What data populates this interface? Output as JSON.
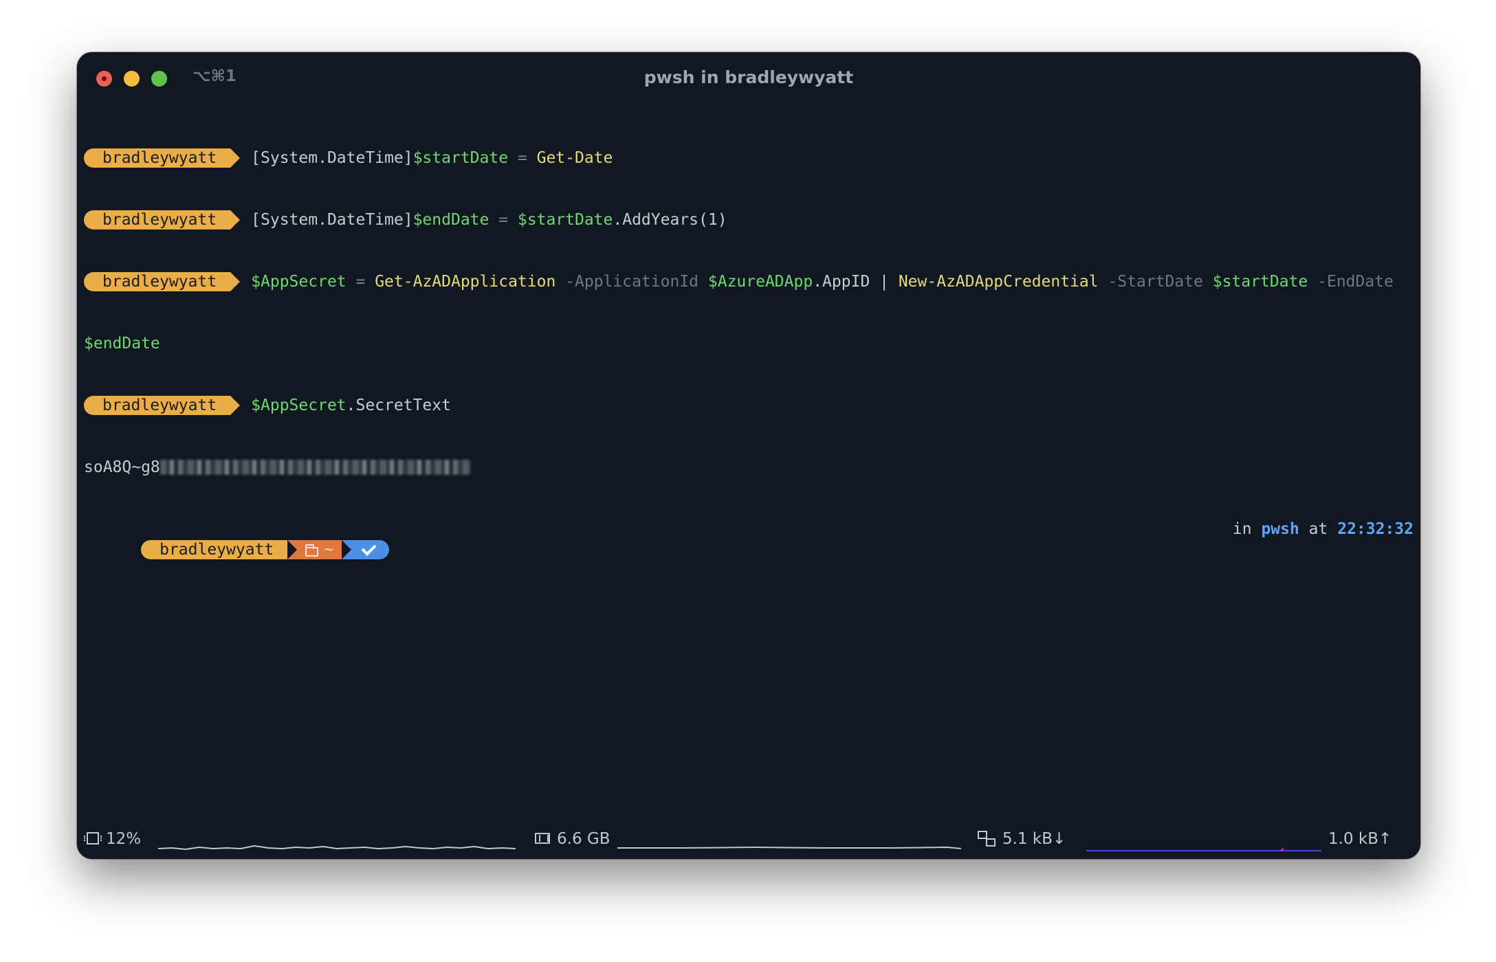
{
  "window": {
    "title": "pwsh in bradleywyatt",
    "shortcut": "⌥⌘1"
  },
  "prompt": {
    "user": "bradleywyatt",
    "dir": "~"
  },
  "commands": [
    {
      "tokens": [
        {
          "t": "[System.DateTime]",
          "c": "plain"
        },
        {
          "t": "$startDate",
          "c": "var"
        },
        {
          "t": " = ",
          "c": "op"
        },
        {
          "t": "Get-Date",
          "c": "kw"
        }
      ]
    },
    {
      "tokens": [
        {
          "t": "[System.DateTime]",
          "c": "plain"
        },
        {
          "t": "$endDate",
          "c": "var"
        },
        {
          "t": " = ",
          "c": "op"
        },
        {
          "t": "$startDate",
          "c": "var"
        },
        {
          "t": ".AddYears(1)",
          "c": "plain"
        }
      ]
    },
    {
      "tokens": [
        {
          "t": "$AppSecret",
          "c": "var"
        },
        {
          "t": " = ",
          "c": "op"
        },
        {
          "t": "Get-AzADApplication",
          "c": "kw"
        },
        {
          "t": " -ApplicationId ",
          "c": "param"
        },
        {
          "t": "$AzureADApp",
          "c": "var"
        },
        {
          "t": ".AppID | ",
          "c": "plain"
        },
        {
          "t": "New-AzADAppCredential",
          "c": "kw"
        },
        {
          "t": " -StartDate ",
          "c": "param"
        },
        {
          "t": "$startDate",
          "c": "var"
        },
        {
          "t": " -EndDate",
          "c": "param"
        }
      ],
      "wrap": "$endDate"
    },
    {
      "tokens": [
        {
          "t": "$AppSecret",
          "c": "var"
        },
        {
          "t": ".SecretText",
          "c": "plain"
        }
      ]
    }
  ],
  "output": {
    "secret_prefix": "soA8Q~g8"
  },
  "right_prompt": {
    "in_label": "in ",
    "shell": "pwsh",
    "at_label": " at ",
    "time": "22:32:32"
  },
  "statusbar": {
    "cpu": "12%",
    "memory": "6.6 GB",
    "net_down": "5.1 kB↓",
    "net_up": "1.0 kB↑",
    "colors": {
      "cpu_line": "#c3c8cf",
      "net_up_line": "#4b45e6",
      "net_up_spike": "#e0407a"
    }
  }
}
